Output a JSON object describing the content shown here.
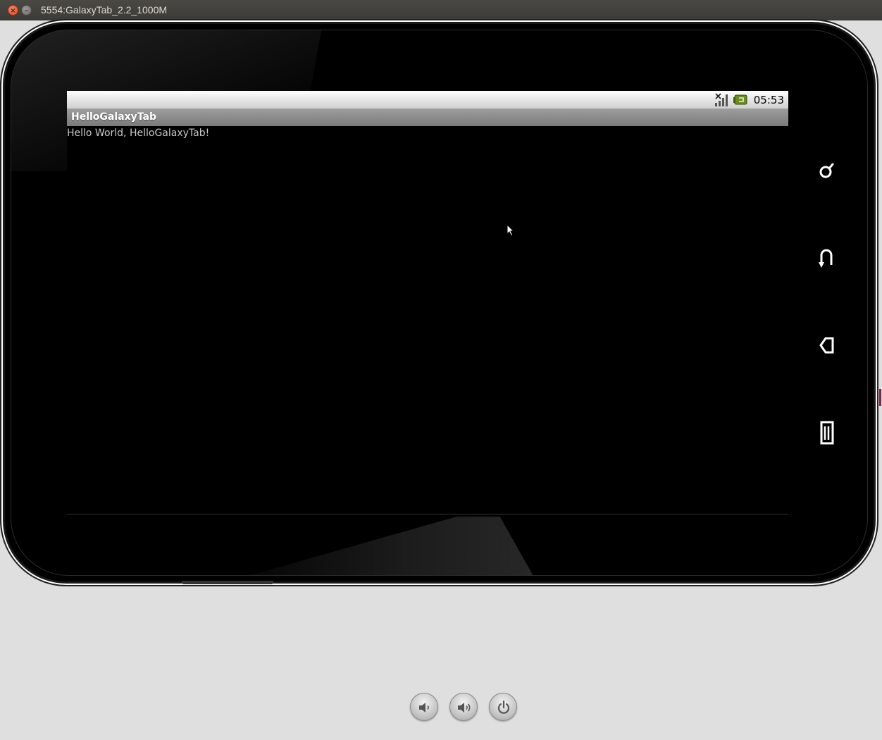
{
  "window": {
    "title": "5554:GalaxyTab_2.2_1000M"
  },
  "statusbar": {
    "time": "05:53",
    "icons": [
      "no-signal-icon",
      "usb-debug-icon"
    ]
  },
  "app": {
    "title": "HelloGalaxyTab",
    "content_text": "Hello World, HelloGalaxyTab!"
  },
  "hardware_keys": [
    "search-key",
    "back-key",
    "home-key",
    "menu-key"
  ],
  "controls": [
    "volume-down-button",
    "volume-up-button",
    "power-button"
  ]
}
